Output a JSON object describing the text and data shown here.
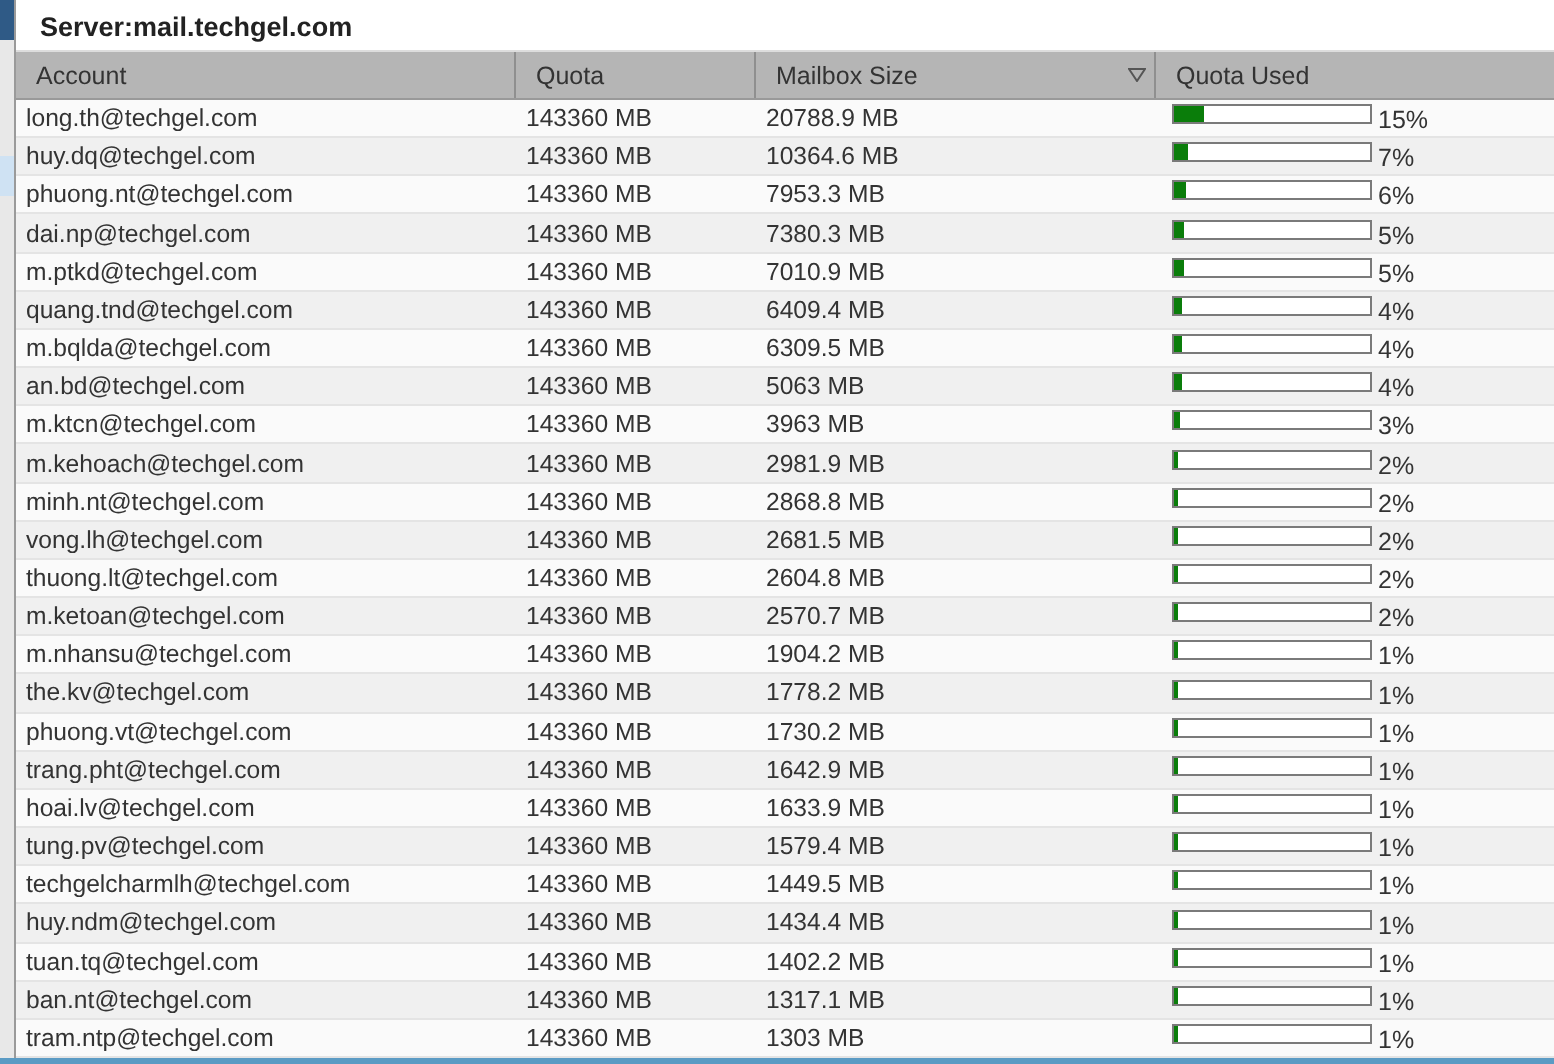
{
  "window": {
    "title": "Server:mail.techgel.com"
  },
  "table": {
    "columns": [
      {
        "label": "Account",
        "sorted": false
      },
      {
        "label": "Quota",
        "sorted": false
      },
      {
        "label": "Mailbox Size",
        "sorted": true
      },
      {
        "label": "Quota Used",
        "sorted": false
      }
    ],
    "rows": [
      {
        "account": "long.th@techgel.com",
        "quota": "143360 MB",
        "size": "20788.9 MB",
        "level": 0.15,
        "used": "15%"
      },
      {
        "account": "huy.dq@techgel.com",
        "quota": "143360 MB",
        "size": "10364.6 MB",
        "level": 0.07,
        "used": "7%"
      },
      {
        "account": "phuong.nt@techgel.com",
        "quota": "143360 MB",
        "size": "7953.3 MB",
        "level": 0.06,
        "used": "6%"
      },
      {
        "account": "dai.np@techgel.com",
        "quota": "143360 MB",
        "size": "7380.3 MB",
        "level": 0.05,
        "used": "5%"
      },
      {
        "account": "m.ptkd@techgel.com",
        "quota": "143360 MB",
        "size": "7010.9 MB",
        "level": 0.05,
        "used": "5%"
      },
      {
        "account": "quang.tnd@techgel.com",
        "quota": "143360 MB",
        "size": "6409.4 MB",
        "level": 0.04,
        "used": "4%"
      },
      {
        "account": "m.bqlda@techgel.com",
        "quota": "143360 MB",
        "size": "6309.5 MB",
        "level": 0.04,
        "used": "4%"
      },
      {
        "account": "an.bd@techgel.com",
        "quota": "143360 MB",
        "size": "5063 MB",
        "level": 0.04,
        "used": "4%"
      },
      {
        "account": "m.ktcn@techgel.com",
        "quota": "143360 MB",
        "size": "3963 MB",
        "level": 0.03,
        "used": "3%"
      },
      {
        "account": "m.kehoach@techgel.com",
        "quota": "143360 MB",
        "size": "2981.9 MB",
        "level": 0.02,
        "used": "2%"
      },
      {
        "account": "minh.nt@techgel.com",
        "quota": "143360 MB",
        "size": "2868.8 MB",
        "level": 0.02,
        "used": "2%"
      },
      {
        "account": "vong.lh@techgel.com",
        "quota": "143360 MB",
        "size": "2681.5 MB",
        "level": 0.02,
        "used": "2%"
      },
      {
        "account": "thuong.lt@techgel.com",
        "quota": "143360 MB",
        "size": "2604.8 MB",
        "level": 0.02,
        "used": "2%"
      },
      {
        "account": "m.ketoan@techgel.com",
        "quota": "143360 MB",
        "size": "2570.7 MB",
        "level": 0.02,
        "used": "2%"
      },
      {
        "account": "m.nhansu@techgel.com",
        "quota": "143360 MB",
        "size": "1904.2 MB",
        "level": 0.01,
        "used": "1%"
      },
      {
        "account": "the.kv@techgel.com",
        "quota": "143360 MB",
        "size": "1778.2 MB",
        "level": 0.01,
        "used": "1%"
      },
      {
        "account": "phuong.vt@techgel.com",
        "quota": "143360 MB",
        "size": "1730.2 MB",
        "level": 0.01,
        "used": "1%"
      },
      {
        "account": "trang.pht@techgel.com",
        "quota": "143360 MB",
        "size": "1642.9 MB",
        "level": 0.01,
        "used": "1%"
      },
      {
        "account": "hoai.lv@techgel.com",
        "quota": "143360 MB",
        "size": "1633.9 MB",
        "level": 0.01,
        "used": "1%"
      },
      {
        "account": "tung.pv@techgel.com",
        "quota": "143360 MB",
        "size": "1579.4 MB",
        "level": 0.01,
        "used": "1%"
      },
      {
        "account": "techgelcharmlh@techgel.com",
        "quota": "143360 MB",
        "size": "1449.5 MB",
        "level": 0.01,
        "used": "1%"
      },
      {
        "account": "huy.ndm@techgel.com",
        "quota": "143360 MB",
        "size": "1434.4 MB",
        "level": 0.01,
        "used": "1%"
      },
      {
        "account": "tuan.tq@techgel.com",
        "quota": "143360 MB",
        "size": "1402.2 MB",
        "level": 0.01,
        "used": "1%"
      },
      {
        "account": "ban.nt@techgel.com",
        "quota": "143360 MB",
        "size": "1317.1 MB",
        "level": 0.01,
        "used": "1%"
      },
      {
        "account": "tram.ntp@techgel.com",
        "quota": "143360 MB",
        "size": "1303 MB",
        "level": 0.01,
        "used": "1%"
      }
    ]
  }
}
